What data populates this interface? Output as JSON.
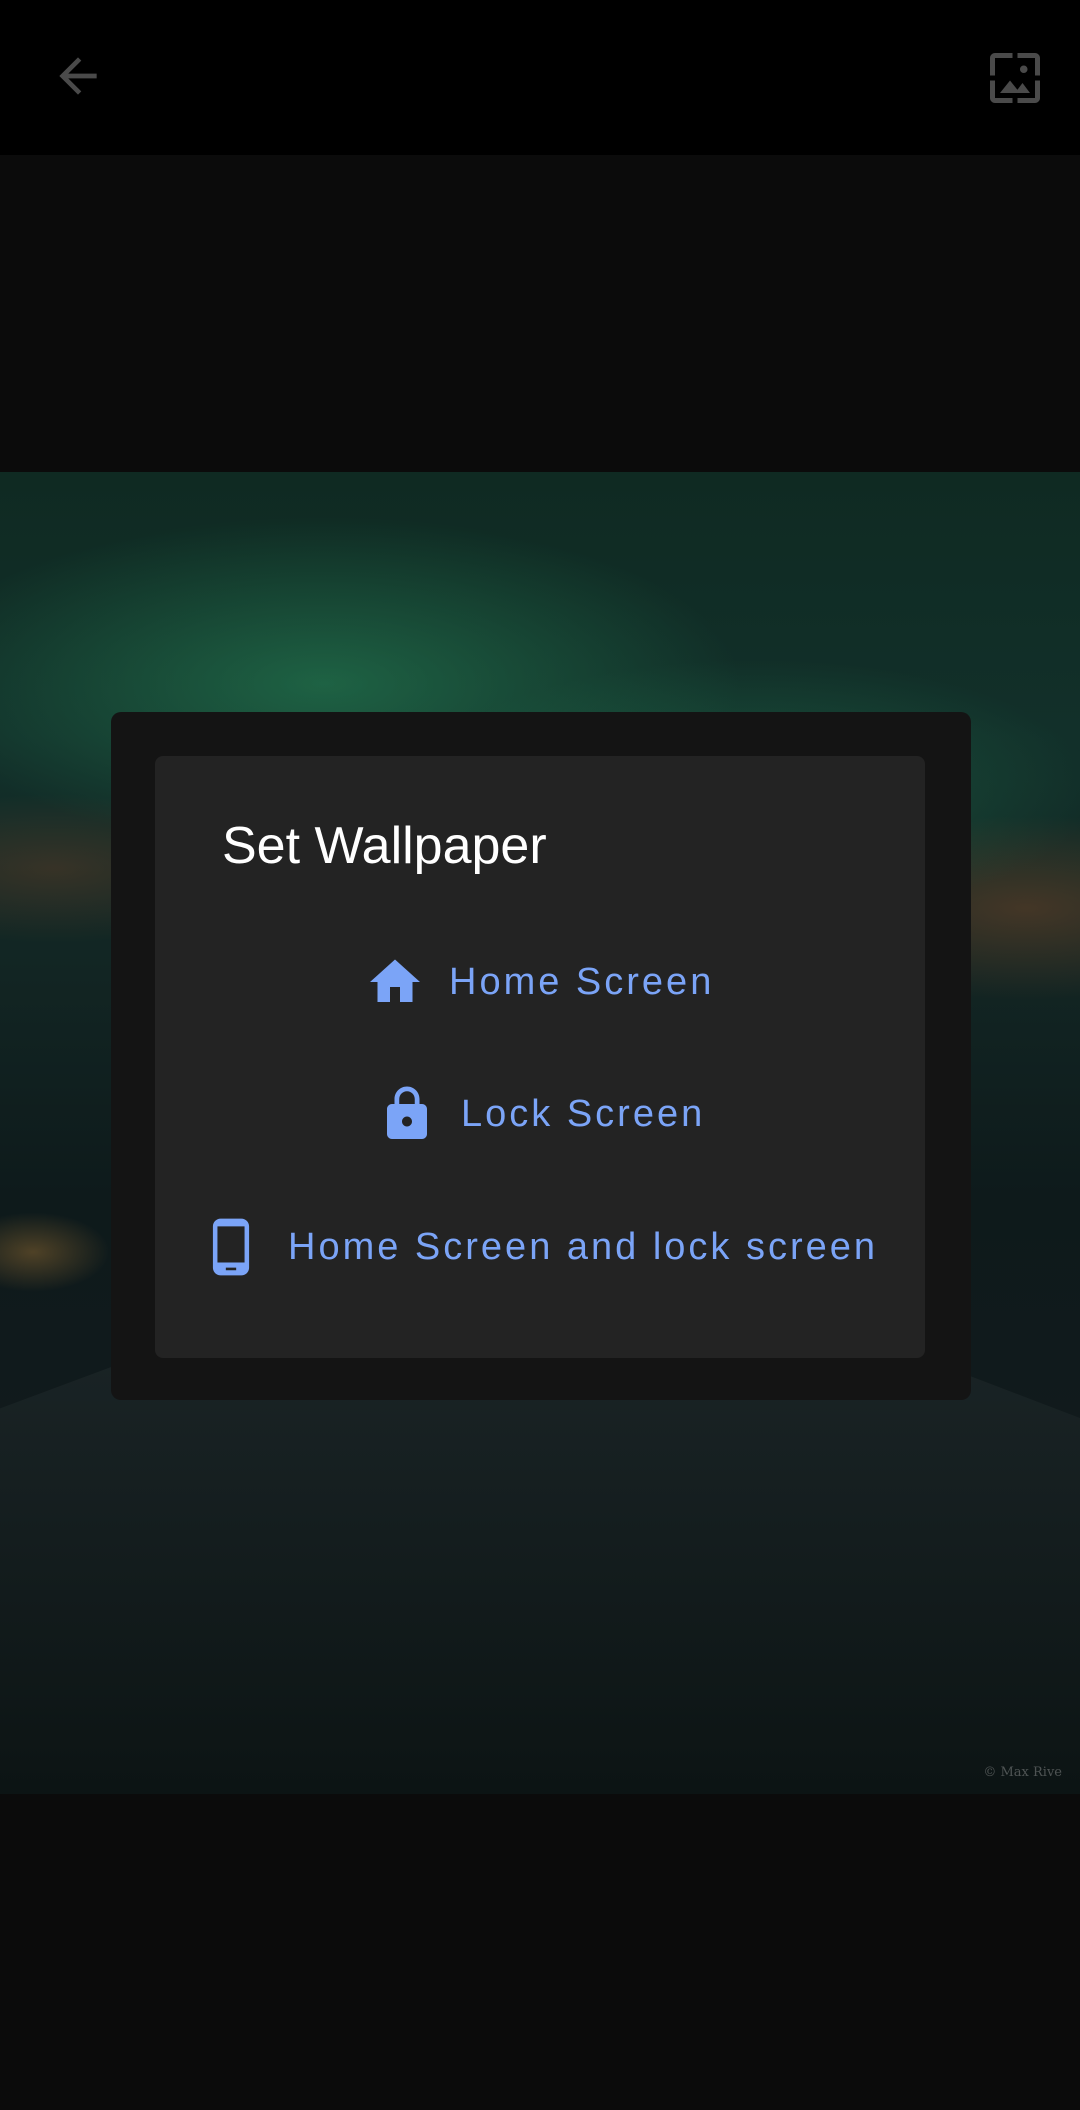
{
  "appbar": {
    "back_icon": "arrow-back-icon",
    "wallpaper_icon": "wallpaper-icon"
  },
  "wallpaper": {
    "credit": "© Max Rive"
  },
  "dialog": {
    "title": "Set Wallpaper",
    "options": [
      {
        "label": "Home Screen",
        "icon": "home-icon"
      },
      {
        "label": "Lock Screen",
        "icon": "lock-icon"
      },
      {
        "label": "Home Screen and lock screen",
        "icon": "phone-icon"
      }
    ]
  },
  "colors": {
    "accent": "#7ba4f7",
    "dialog_bg": "#232323",
    "appbar_bg": "#000000",
    "apply_button": "#7a1f14"
  }
}
